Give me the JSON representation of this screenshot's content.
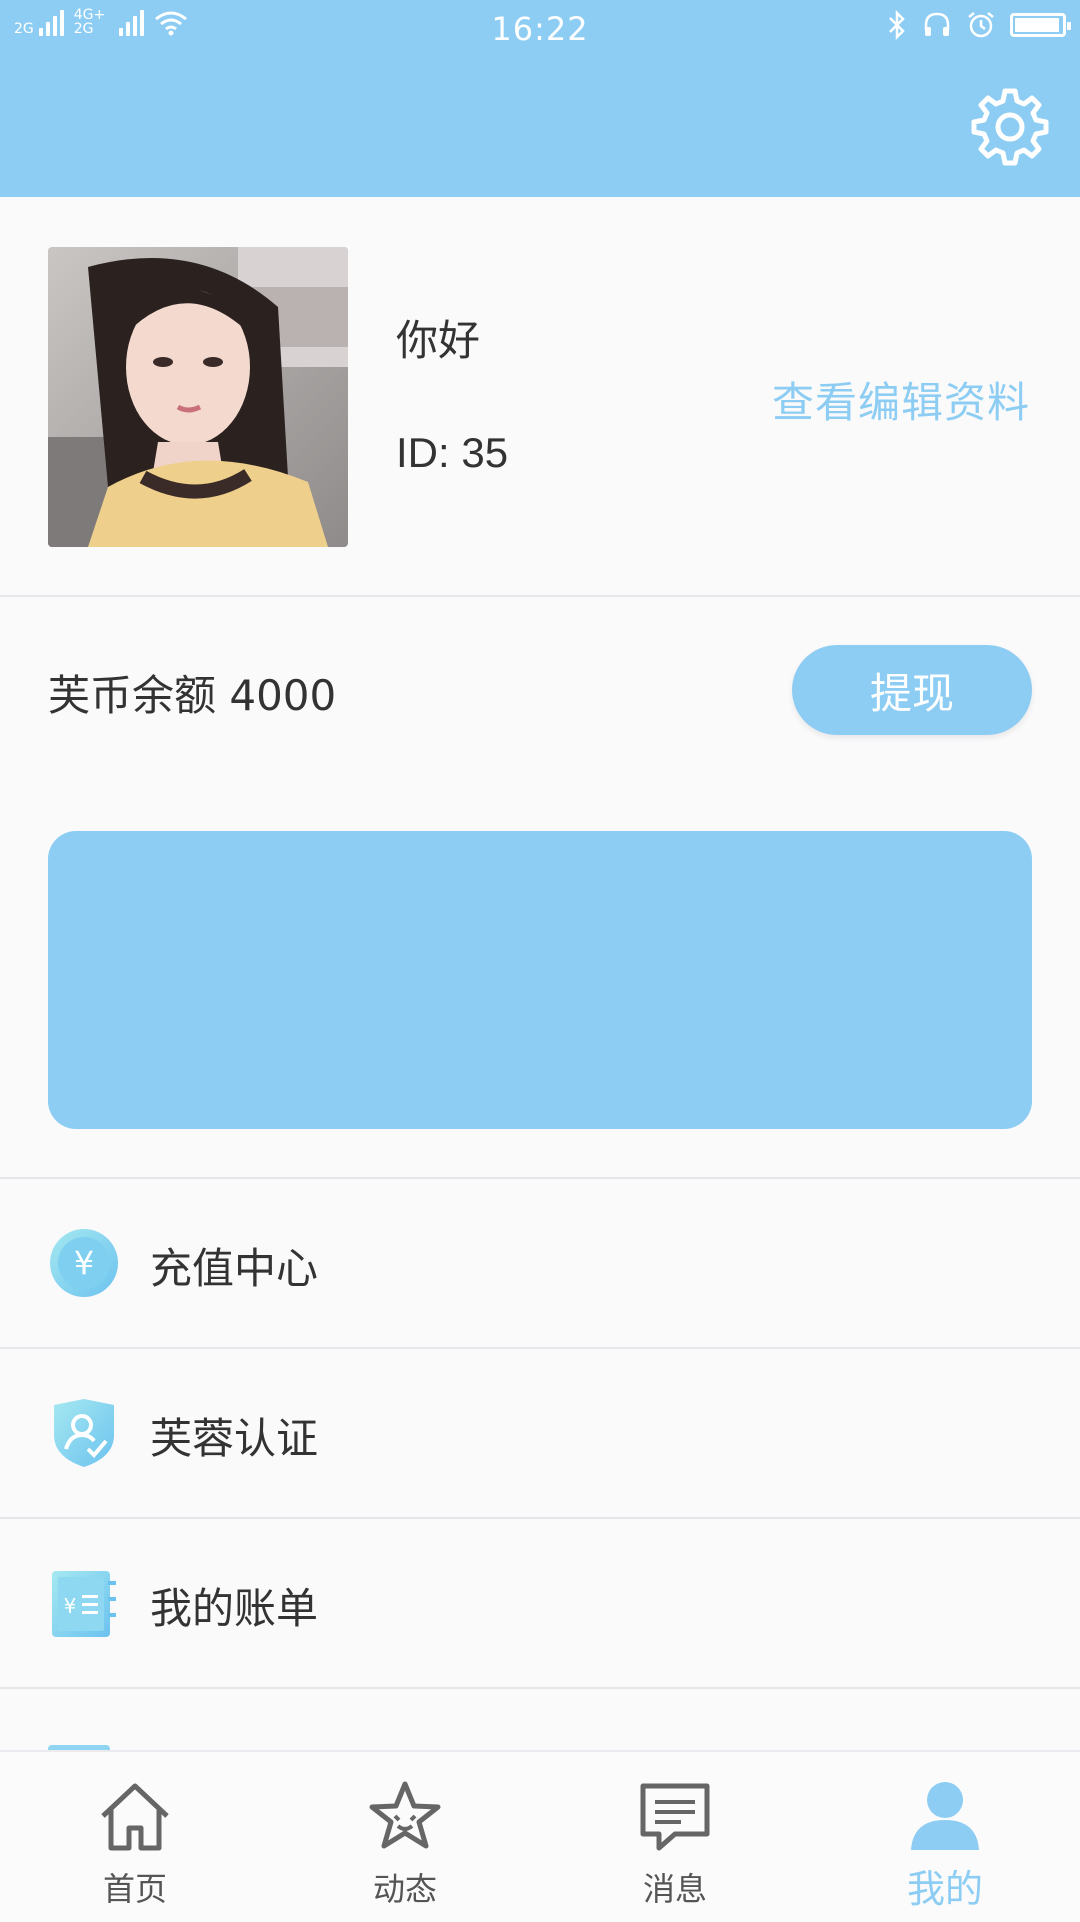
{
  "status_bar": {
    "net_label_1": "2G",
    "net_label_2": "4G+ 2G",
    "time": "16:22",
    "battery_level": 0.95
  },
  "profile": {
    "nickname": "你好",
    "id_text": "ID: 35",
    "edit_label": "查看编辑资料"
  },
  "balance": {
    "text": "芙币余额 4000",
    "withdraw_label": "提现"
  },
  "menu": {
    "items": [
      {
        "label": "充值中心",
        "icon": "coin-yuan-icon"
      },
      {
        "label": "芙蓉认证",
        "icon": "shield-user-icon"
      },
      {
        "label": "我的账单",
        "icon": "bill-book-icon"
      }
    ]
  },
  "tabbar": {
    "tabs": [
      {
        "label": "首页",
        "icon": "home-icon"
      },
      {
        "label": "动态",
        "icon": "star-face-icon"
      },
      {
        "label": "消息",
        "icon": "message-icon"
      },
      {
        "label": "我的",
        "icon": "person-icon",
        "active": true
      }
    ]
  },
  "colors": {
    "accent": "#8dcdf3",
    "background": "#fafafb",
    "divider": "#e4e6ea"
  }
}
